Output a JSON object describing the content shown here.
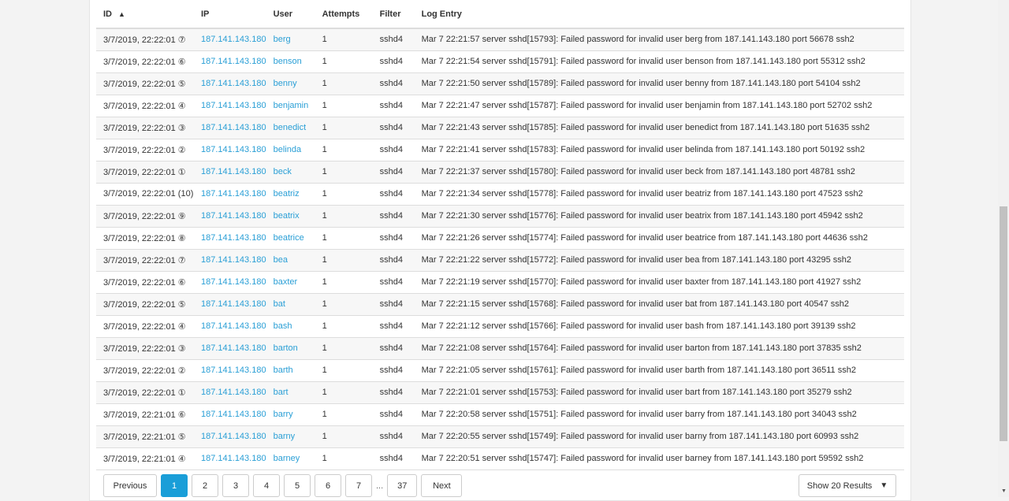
{
  "columns": {
    "id": "ID",
    "ip": "IP",
    "user": "User",
    "attempts": "Attempts",
    "filter": "Filter",
    "log": "Log Entry"
  },
  "sort_icon": "caret-up-icon",
  "rows": [
    {
      "id": "3/7/2019, 22:22:01 ⑦",
      "ip": "187.141.143.180",
      "user": "berg",
      "attempts": "1",
      "filter": "sshd4",
      "log": "Mar 7 22:21:57 server sshd[15793]: Failed password for invalid user berg from 187.141.143.180 port 56678 ssh2"
    },
    {
      "id": "3/7/2019, 22:22:01 ⑥",
      "ip": "187.141.143.180",
      "user": "benson",
      "attempts": "1",
      "filter": "sshd4",
      "log": "Mar 7 22:21:54 server sshd[15791]: Failed password for invalid user benson from 187.141.143.180 port 55312 ssh2"
    },
    {
      "id": "3/7/2019, 22:22:01 ⑤",
      "ip": "187.141.143.180",
      "user": "benny",
      "attempts": "1",
      "filter": "sshd4",
      "log": "Mar 7 22:21:50 server sshd[15789]: Failed password for invalid user benny from 187.141.143.180 port 54104 ssh2"
    },
    {
      "id": "3/7/2019, 22:22:01 ④",
      "ip": "187.141.143.180",
      "user": "benjamin",
      "attempts": "1",
      "filter": "sshd4",
      "log": "Mar 7 22:21:47 server sshd[15787]: Failed password for invalid user benjamin from 187.141.143.180 port 52702 ssh2"
    },
    {
      "id": "3/7/2019, 22:22:01 ③",
      "ip": "187.141.143.180",
      "user": "benedict",
      "attempts": "1",
      "filter": "sshd4",
      "log": "Mar 7 22:21:43 server sshd[15785]: Failed password for invalid user benedict from 187.141.143.180 port 51635 ssh2"
    },
    {
      "id": "3/7/2019, 22:22:01 ②",
      "ip": "187.141.143.180",
      "user": "belinda",
      "attempts": "1",
      "filter": "sshd4",
      "log": "Mar 7 22:21:41 server sshd[15783]: Failed password for invalid user belinda from 187.141.143.180 port 50192 ssh2"
    },
    {
      "id": "3/7/2019, 22:22:01 ①",
      "ip": "187.141.143.180",
      "user": "beck",
      "attempts": "1",
      "filter": "sshd4",
      "log": "Mar 7 22:21:37 server sshd[15780]: Failed password for invalid user beck from 187.141.143.180 port 48781 ssh2"
    },
    {
      "id": "3/7/2019, 22:22:01 (10)",
      "ip": "187.141.143.180",
      "user": "beatriz",
      "attempts": "1",
      "filter": "sshd4",
      "log": "Mar 7 22:21:34 server sshd[15778]: Failed password for invalid user beatriz from 187.141.143.180 port 47523 ssh2"
    },
    {
      "id": "3/7/2019, 22:22:01 ⑨",
      "ip": "187.141.143.180",
      "user": "beatrix",
      "attempts": "1",
      "filter": "sshd4",
      "log": "Mar 7 22:21:30 server sshd[15776]: Failed password for invalid user beatrix from 187.141.143.180 port 45942 ssh2"
    },
    {
      "id": "3/7/2019, 22:22:01 ⑧",
      "ip": "187.141.143.180",
      "user": "beatrice",
      "attempts": "1",
      "filter": "sshd4",
      "log": "Mar 7 22:21:26 server sshd[15774]: Failed password for invalid user beatrice from 187.141.143.180 port 44636 ssh2"
    },
    {
      "id": "3/7/2019, 22:22:01 ⑦",
      "ip": "187.141.143.180",
      "user": "bea",
      "attempts": "1",
      "filter": "sshd4",
      "log": "Mar 7 22:21:22 server sshd[15772]: Failed password for invalid user bea from 187.141.143.180 port 43295 ssh2"
    },
    {
      "id": "3/7/2019, 22:22:01 ⑥",
      "ip": "187.141.143.180",
      "user": "baxter",
      "attempts": "1",
      "filter": "sshd4",
      "log": "Mar 7 22:21:19 server sshd[15770]: Failed password for invalid user baxter from 187.141.143.180 port 41927 ssh2"
    },
    {
      "id": "3/7/2019, 22:22:01 ⑤",
      "ip": "187.141.143.180",
      "user": "bat",
      "attempts": "1",
      "filter": "sshd4",
      "log": "Mar 7 22:21:15 server sshd[15768]: Failed password for invalid user bat from 187.141.143.180 port 40547 ssh2"
    },
    {
      "id": "3/7/2019, 22:22:01 ④",
      "ip": "187.141.143.180",
      "user": "bash",
      "attempts": "1",
      "filter": "sshd4",
      "log": "Mar 7 22:21:12 server sshd[15766]: Failed password for invalid user bash from 187.141.143.180 port 39139 ssh2"
    },
    {
      "id": "3/7/2019, 22:22:01 ③",
      "ip": "187.141.143.180",
      "user": "barton",
      "attempts": "1",
      "filter": "sshd4",
      "log": "Mar 7 22:21:08 server sshd[15764]: Failed password for invalid user barton from 187.141.143.180 port 37835 ssh2"
    },
    {
      "id": "3/7/2019, 22:22:01 ②",
      "ip": "187.141.143.180",
      "user": "barth",
      "attempts": "1",
      "filter": "sshd4",
      "log": "Mar 7 22:21:05 server sshd[15761]: Failed password for invalid user barth from 187.141.143.180 port 36511 ssh2"
    },
    {
      "id": "3/7/2019, 22:22:01 ①",
      "ip": "187.141.143.180",
      "user": "bart",
      "attempts": "1",
      "filter": "sshd4",
      "log": "Mar 7 22:21:01 server sshd[15753]: Failed password for invalid user bart from 187.141.143.180 port 35279 ssh2"
    },
    {
      "id": "3/7/2019, 22:21:01 ⑥",
      "ip": "187.141.143.180",
      "user": "barry",
      "attempts": "1",
      "filter": "sshd4",
      "log": "Mar 7 22:20:58 server sshd[15751]: Failed password for invalid user barry from 187.141.143.180 port 34043 ssh2"
    },
    {
      "id": "3/7/2019, 22:21:01 ⑤",
      "ip": "187.141.143.180",
      "user": "barny",
      "attempts": "1",
      "filter": "sshd4",
      "log": "Mar 7 22:20:55 server sshd[15749]: Failed password for invalid user barny from 187.141.143.180 port 60993 ssh2"
    },
    {
      "id": "3/7/2019, 22:21:01 ④",
      "ip": "187.141.143.180",
      "user": "barney",
      "attempts": "1",
      "filter": "sshd4",
      "log": "Mar 7 22:20:51 server sshd[15747]: Failed password for invalid user barney from 187.141.143.180 port 59592 ssh2"
    }
  ],
  "pagination": {
    "previous": "Previous",
    "pages": [
      "1",
      "2",
      "3",
      "4",
      "5",
      "6",
      "7"
    ],
    "ellipsis": "...",
    "last": "37",
    "next": "Next",
    "current": "1"
  },
  "page_size": {
    "label": "Show 20 Results"
  },
  "colors": {
    "link": "#2a9fd6",
    "active": "#1a9ed8"
  }
}
